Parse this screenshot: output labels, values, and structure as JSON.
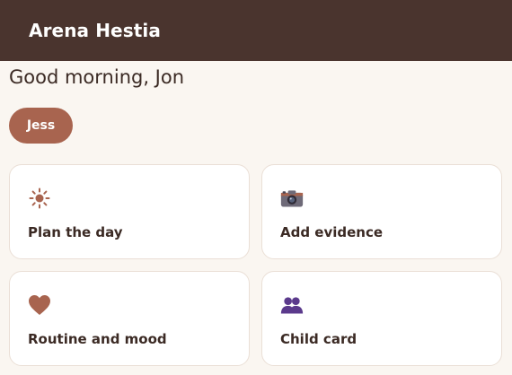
{
  "app": {
    "title": "Arena Hestia"
  },
  "greeting": "Good morning, Jon",
  "child_selector": {
    "selected": "Jess"
  },
  "cards": [
    {
      "label": "Plan the day",
      "icon": "sun-icon"
    },
    {
      "label": "Add evidence",
      "icon": "camera-icon"
    },
    {
      "label": "Routine and mood",
      "icon": "heart-icon"
    },
    {
      "label": "Child card",
      "icon": "people-icon"
    }
  ],
  "colors": {
    "header_bg": "#4a342e",
    "page_bg": "#faf6f1",
    "accent": "#a8644f",
    "people_icon": "#5b3a8c"
  }
}
